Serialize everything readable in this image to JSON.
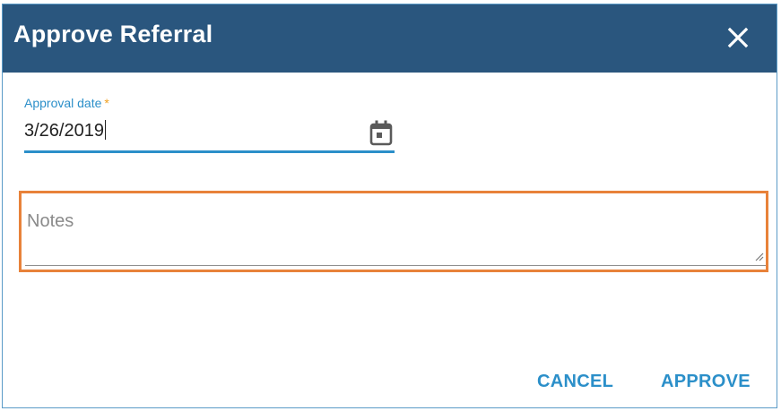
{
  "dialog": {
    "title": "Approve Referral",
    "close_icon": "close-icon"
  },
  "approval_date": {
    "label": "Approval date",
    "required_marker": "*",
    "value": "3/26/2019",
    "icon": "calendar-icon"
  },
  "notes": {
    "placeholder": "Notes",
    "value": ""
  },
  "actions": {
    "cancel_label": "CANCEL",
    "approve_label": "APPROVE"
  },
  "colors": {
    "header_bg": "#2a567e",
    "accent": "#2b8fc9",
    "required": "#f0a020",
    "highlight": "#e8823a"
  }
}
